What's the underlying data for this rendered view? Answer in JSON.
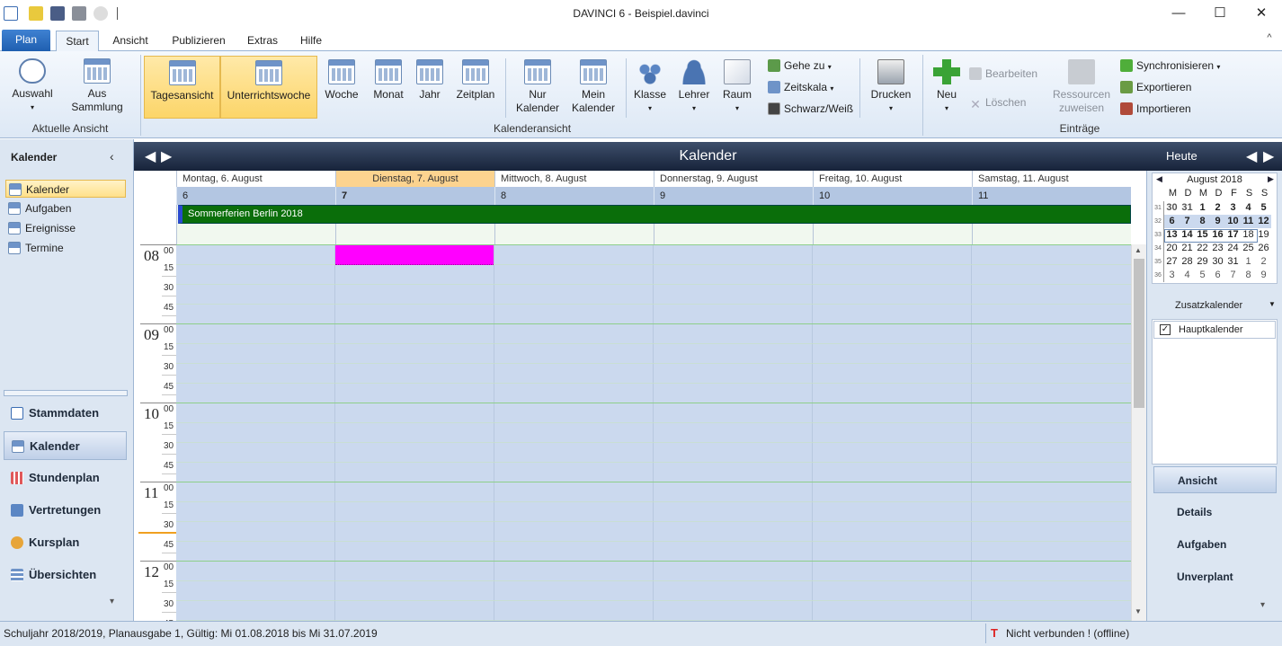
{
  "app": {
    "title": "DAVINCI 6 - Beispiel.davinci"
  },
  "window_controls": {
    "minimize": "—",
    "maximize": "☐",
    "close": "✕"
  },
  "menu": {
    "plan": "Plan",
    "tabs": [
      "Start",
      "Ansicht",
      "Publizieren",
      "Extras",
      "Hilfe"
    ],
    "help_symbol": "^"
  },
  "ribbon": {
    "aktuelle_ansicht": {
      "label": "Aktuelle Ansicht",
      "buttons": [
        "Auswahl",
        "Aus Sammlung"
      ]
    },
    "kalenderansicht": {
      "label": "Kalenderansicht",
      "buttons": [
        "Tagesansicht",
        "Unterrichtswoche",
        "Woche",
        "Monat",
        "Jahr",
        "Zeitplan",
        "Nur Kalender",
        "Mein Kalender",
        "Klasse",
        "Lehrer",
        "Raum"
      ],
      "small": [
        "Gehe zu",
        "Zeitskala",
        "Schwarz/Weiß"
      ],
      "print": "Drucken"
    },
    "eintraege": {
      "label": "Einträge",
      "neu": "Neu",
      "bearbeiten": "Bearbeiten",
      "loeschen": "Löschen",
      "ressourcen": "Ressourcen zuweisen",
      "small": [
        "Synchronisieren",
        "Exportieren",
        "Importieren"
      ]
    }
  },
  "left_pane": {
    "title": "Kalender",
    "collapse": "‹",
    "items": [
      "Kalender",
      "Aufgaben",
      "Ereignisse",
      "Termine"
    ],
    "nav": [
      "Stammdaten",
      "Kalender",
      "Stundenplan",
      "Vertretungen",
      "Kursplan",
      "Übersichten"
    ],
    "more": "▾"
  },
  "calendar": {
    "title": "Kalender",
    "today": "Heute",
    "days": [
      {
        "header": "Montag, 6. August",
        "num": "6"
      },
      {
        "header": "Dienstag, 7. August",
        "num": "7"
      },
      {
        "header": "Mittwoch, 8. August",
        "num": "8"
      },
      {
        "header": "Donnerstag, 9. August",
        "num": "9"
      },
      {
        "header": "Freitag, 10. August",
        "num": "10"
      },
      {
        "header": "Samstag, 11. August",
        "num": "11"
      }
    ],
    "allday_event": "Sommerferien Berlin 2018",
    "hours": [
      "08",
      "09",
      "10",
      "11",
      "12"
    ],
    "minutes_zero": "00",
    "minutes": [
      "15",
      "30",
      "45"
    ]
  },
  "mini_calendar": {
    "month": "August 2018",
    "weekdays": [
      "M",
      "D",
      "M",
      "D",
      "F",
      "S",
      "S"
    ],
    "weeks": [
      {
        "kw": "31",
        "days": [
          "30",
          "31",
          "1",
          "2",
          "3",
          "4",
          "5"
        ]
      },
      {
        "kw": "32",
        "days": [
          "6",
          "7",
          "8",
          "9",
          "10",
          "11",
          "12"
        ]
      },
      {
        "kw": "33",
        "days": [
          "13",
          "14",
          "15",
          "16",
          "17",
          "18",
          "19"
        ]
      },
      {
        "kw": "34",
        "days": [
          "20",
          "21",
          "22",
          "23",
          "24",
          "25",
          "26"
        ]
      },
      {
        "kw": "35",
        "days": [
          "27",
          "28",
          "29",
          "30",
          "31",
          "1",
          "2"
        ]
      },
      {
        "kw": "36",
        "days": [
          "3",
          "4",
          "5",
          "6",
          "7",
          "8",
          "9"
        ]
      }
    ]
  },
  "right_pane": {
    "zusatz": "Zusatzkalender",
    "hauptkalender": "Hauptkalender",
    "buttons": [
      "Ansicht",
      "Details",
      "Aufgaben",
      "Unverplant"
    ]
  },
  "status": {
    "left": "Schuljahr 2018/2019, Planausgabe 1, Gültig: Mi 01.08.2018 bis Mi 31.07.2019",
    "right": "Nicht verbunden ! (offline)"
  },
  "colors": {
    "accent": "#2a6fc9",
    "event_allday": "#0a6e0a",
    "event_magenta": "#ff00ff",
    "today_header": "#fcd38f",
    "now_line": "#f0a020"
  }
}
